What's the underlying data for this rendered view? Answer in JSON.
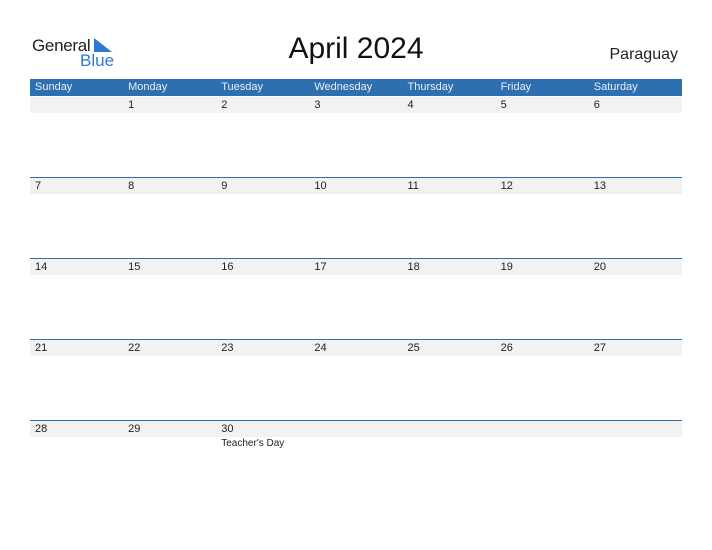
{
  "logo": {
    "line1": "General",
    "line2": "Blue"
  },
  "title": "April 2024",
  "country": "Paraguay",
  "colors": {
    "header": "#2e6fb0",
    "logo_blue": "#2b7bd4",
    "row_bg": "#f2f2f2"
  },
  "weekdays": [
    "Sunday",
    "Monday",
    "Tuesday",
    "Wednesday",
    "Thursday",
    "Friday",
    "Saturday"
  ],
  "weeks": [
    {
      "days": [
        "",
        "1",
        "2",
        "3",
        "4",
        "5",
        "6"
      ],
      "events": [
        "",
        "",
        "",
        "",
        "",
        "",
        ""
      ]
    },
    {
      "days": [
        "7",
        "8",
        "9",
        "10",
        "11",
        "12",
        "13"
      ],
      "events": [
        "",
        "",
        "",
        "",
        "",
        "",
        ""
      ]
    },
    {
      "days": [
        "14",
        "15",
        "16",
        "17",
        "18",
        "19",
        "20"
      ],
      "events": [
        "",
        "",
        "",
        "",
        "",
        "",
        ""
      ]
    },
    {
      "days": [
        "21",
        "22",
        "23",
        "24",
        "25",
        "26",
        "27"
      ],
      "events": [
        "",
        "",
        "",
        "",
        "",
        "",
        ""
      ]
    },
    {
      "days": [
        "28",
        "29",
        "30",
        "",
        "",
        "",
        ""
      ],
      "events": [
        "",
        "",
        "Teacher's Day",
        "",
        "",
        "",
        ""
      ]
    }
  ]
}
